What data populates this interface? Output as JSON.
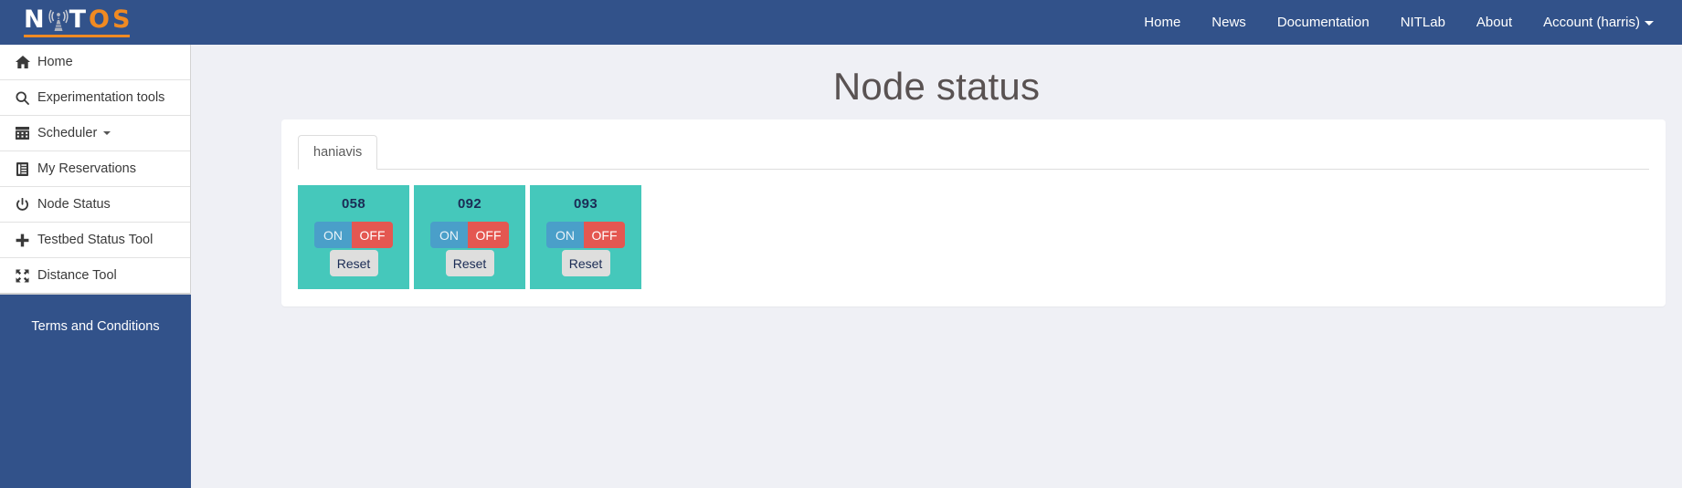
{
  "navbar": {
    "brand": {
      "text_before": "N",
      "icon": "antenna-tower-icon",
      "text_white": "T",
      "text_orange": "OS",
      "full_text": "NITOS",
      "color_white": "#ffffff",
      "color_orange": "#f08a22"
    },
    "links": [
      {
        "label": "Home",
        "name": "nav-link-home",
        "has_caret": false
      },
      {
        "label": "News",
        "name": "nav-link-news",
        "has_caret": false
      },
      {
        "label": "Documentation",
        "name": "nav-link-documentation",
        "has_caret": false
      },
      {
        "label": "NITLab",
        "name": "nav-link-nitlab",
        "has_caret": false
      },
      {
        "label": "About",
        "name": "nav-link-about",
        "has_caret": false
      },
      {
        "label": "Account (harris)",
        "name": "nav-link-account",
        "has_caret": true
      }
    ],
    "background_color": "#32528a"
  },
  "sidebar": {
    "items": [
      {
        "label": "Home",
        "icon": "home-icon",
        "has_caret": false
      },
      {
        "label": "Experimentation tools",
        "icon": "search-icon",
        "has_caret": false
      },
      {
        "label": "Scheduler",
        "icon": "calendar-icon",
        "has_caret": true
      },
      {
        "label": "My Reservations",
        "icon": "list-document-icon",
        "has_caret": false
      },
      {
        "label": "Node Status",
        "icon": "power-icon",
        "has_caret": false
      },
      {
        "label": "Testbed Status Tool",
        "icon": "plus-icon",
        "has_caret": false
      },
      {
        "label": "Distance Tool",
        "icon": "expand-arrows-icon",
        "has_caret": false
      }
    ],
    "terms_label": "Terms and Conditions",
    "background_color": "#32528a"
  },
  "main": {
    "page_title": "Node status",
    "tabs": [
      {
        "label": "haniavis",
        "active": true
      }
    ],
    "nodes": [
      {
        "name": "058",
        "on_label": "ON",
        "off_label": "OFF",
        "reset_label": "Reset"
      },
      {
        "name": "092",
        "on_label": "ON",
        "off_label": "OFF",
        "reset_label": "Reset"
      },
      {
        "name": "093",
        "on_label": "ON",
        "off_label": "OFF",
        "reset_label": "Reset"
      }
    ],
    "colors": {
      "node_card": "#45c8bb",
      "on_button": "#4a9fc9",
      "off_button": "#e45751",
      "reset_button": "#dededd",
      "page_background": "#eff0f5"
    }
  }
}
